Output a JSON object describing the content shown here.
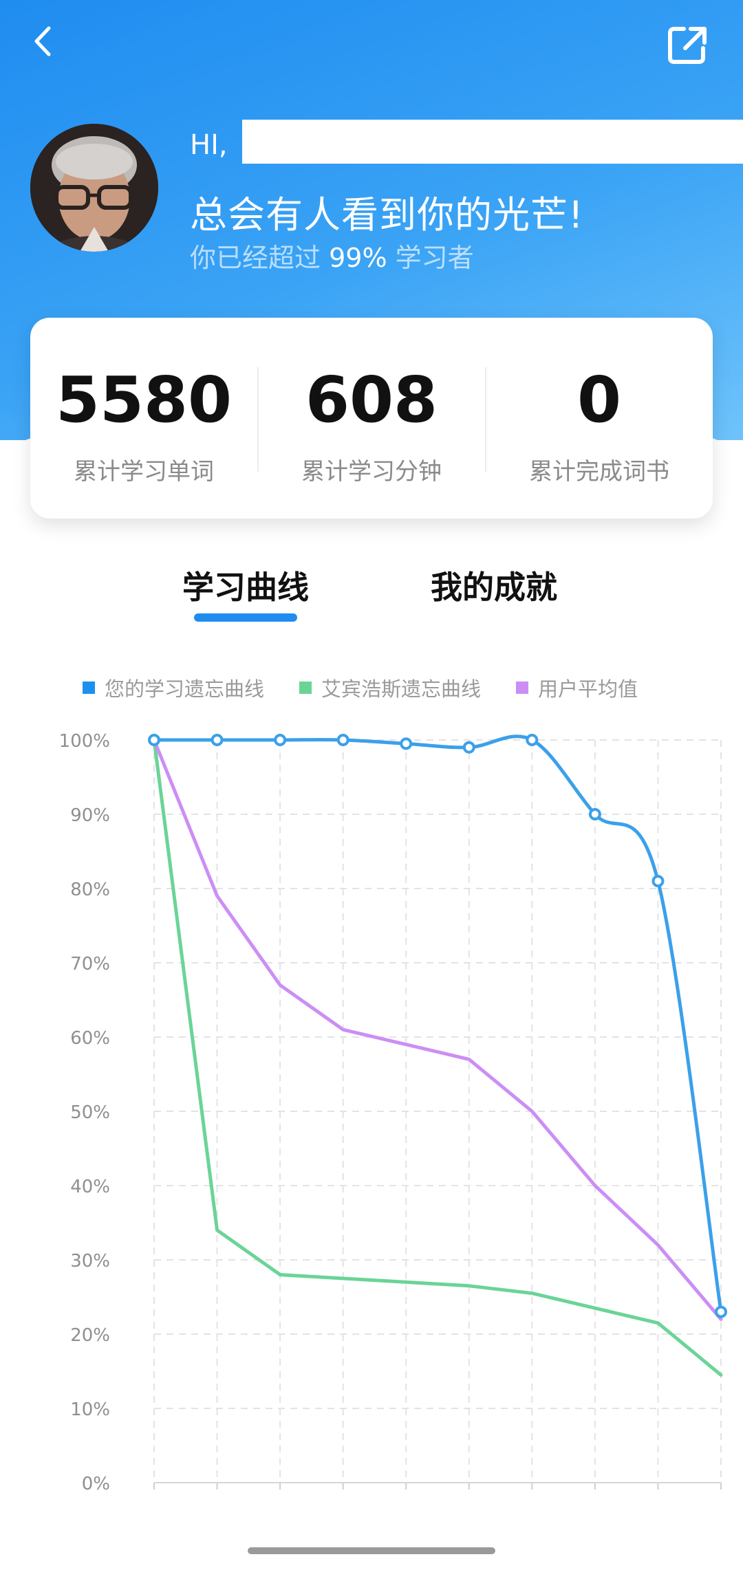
{
  "header": {
    "greeting": "HI,",
    "slogan": "总会有人看到你的光芒!",
    "rank_prefix": "你已经超过",
    "rank_percent": "99%",
    "rank_suffix": "学习者"
  },
  "stats": [
    {
      "value": "5580",
      "label": "累计学习单词"
    },
    {
      "value": "608",
      "label": "累计学习分钟"
    },
    {
      "value": "0",
      "label": "累计完成词书"
    }
  ],
  "tabs": [
    {
      "label": "学习曲线",
      "active": true
    },
    {
      "label": "我的成就",
      "active": false
    }
  ],
  "colors": {
    "accent": "#1f8cf0",
    "series_user": "#3ba0ea",
    "series_ebbinghaus": "#6ad497",
    "series_average": "#cc8ef5"
  },
  "chart_data": {
    "type": "line",
    "ylim": [
      0,
      100
    ],
    "y_ticks": [
      "0%",
      "10%",
      "20%",
      "30%",
      "40%",
      "50%",
      "60%",
      "70%",
      "80%",
      "90%",
      "100%"
    ],
    "x_count": 10,
    "grid": true,
    "legend": "top",
    "series": [
      {
        "name": "您的学习遗忘曲线",
        "values": [
          100,
          100,
          100,
          100,
          99.5,
          99,
          100,
          90,
          81,
          23
        ]
      },
      {
        "name": "艾宾浩斯遗忘曲线",
        "values": [
          100,
          34,
          28,
          27.5,
          27,
          26.5,
          25.5,
          23.5,
          21.5,
          14.5
        ]
      },
      {
        "name": "用户平均值",
        "values": [
          100,
          79,
          67,
          61,
          59,
          57,
          50,
          40,
          32,
          22
        ]
      }
    ]
  }
}
